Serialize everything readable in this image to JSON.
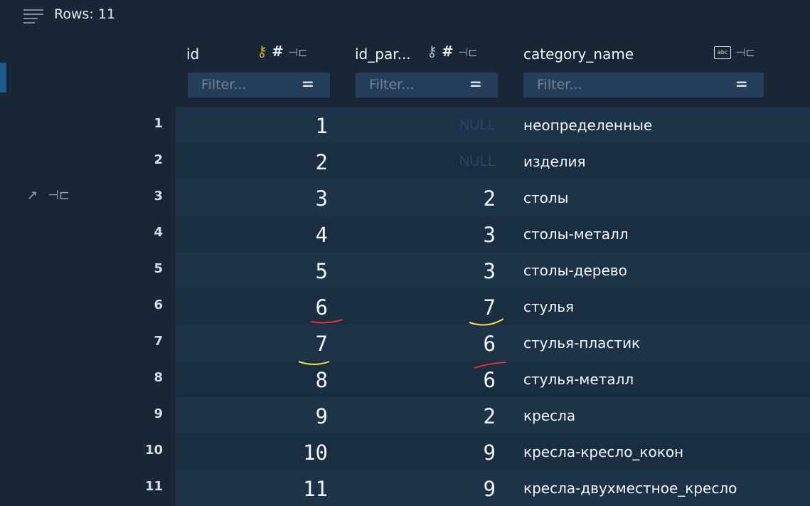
{
  "toolbar": {
    "rows_label": "Rows: 11"
  },
  "columns": [
    {
      "name": "id",
      "icons": [
        "key-icon",
        "hash-icon",
        "pin-icon"
      ],
      "filter_placeholder": "Filter..."
    },
    {
      "name": "id_par...",
      "icons": [
        "key-icon",
        "hash-icon",
        "pin-icon"
      ],
      "filter_placeholder": "Filter..."
    },
    {
      "name": "category_name",
      "icons": [
        "abc-icon",
        "pin-icon"
      ],
      "filter_placeholder": "Filter..."
    }
  ],
  "rows": [
    {
      "num": "1",
      "id": "1",
      "id_parent": "NULL",
      "category_name": "неопределенные"
    },
    {
      "num": "2",
      "id": "2",
      "id_parent": "NULL",
      "category_name": "изделия"
    },
    {
      "num": "3",
      "id": "3",
      "id_parent": "2",
      "category_name": "столы"
    },
    {
      "num": "4",
      "id": "4",
      "id_parent": "3",
      "category_name": "столы-металл"
    },
    {
      "num": "5",
      "id": "5",
      "id_parent": "3",
      "category_name": "столы-дерево"
    },
    {
      "num": "6",
      "id": "6",
      "id_parent": "7",
      "category_name": "стулья"
    },
    {
      "num": "7",
      "id": "7",
      "id_parent": "6",
      "category_name": "стулья-пластик"
    },
    {
      "num": "8",
      "id": "8",
      "id_parent": "6",
      "category_name": "стулья-металл"
    },
    {
      "num": "9",
      "id": "9",
      "id_parent": "2",
      "category_name": "кресла"
    },
    {
      "num": "10",
      "id": "10",
      "id_parent": "9",
      "category_name": "кресла-кресло_кокон"
    },
    {
      "num": "11",
      "id": "11",
      "id_parent": "9",
      "category_name": "кресла-двухместное_кресло"
    }
  ],
  "colors": {
    "background": "#182635",
    "filter_bg": "#253f5a",
    "key_gold": "#e1a53f",
    "annotation_red": "#e0352b",
    "annotation_yellow": "#f3e24a"
  }
}
